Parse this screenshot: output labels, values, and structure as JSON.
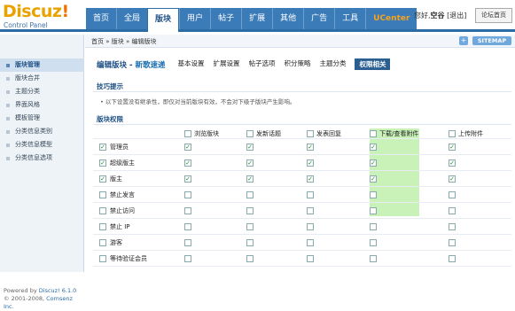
{
  "header": {
    "logo_word": "Discuz",
    "logo_bang": "!",
    "logo_sub": "Control Panel",
    "nav": [
      {
        "label": "首页",
        "active": false
      },
      {
        "label": "全局",
        "active": false
      },
      {
        "label": "版块",
        "active": true
      },
      {
        "label": "用户",
        "active": false
      },
      {
        "label": "帖子",
        "active": false
      },
      {
        "label": "扩展",
        "active": false
      },
      {
        "label": "其他",
        "active": false
      },
      {
        "label": "广告",
        "active": false
      },
      {
        "label": "工具",
        "active": false
      },
      {
        "label": "UCenter",
        "active": false
      }
    ],
    "greeting": "您好,",
    "username": "空谷",
    "logout": "[退出]",
    "home_button": "论坛首页"
  },
  "sidebar": {
    "items": [
      {
        "label": "版块管理",
        "active": true
      },
      {
        "label": "版块合并",
        "active": false
      },
      {
        "label": "主题分类",
        "active": false
      },
      {
        "label": "界面风格",
        "active": false
      },
      {
        "label": "模板管理",
        "active": false
      },
      {
        "label": "分类信息类别",
        "active": false
      },
      {
        "label": "分类信息模型",
        "active": false
      },
      {
        "label": "分类信息选项",
        "active": false
      }
    ],
    "footer_powered": "Powered by",
    "footer_product": "Discuz! 6.1.0",
    "footer_copy": "© 2001-2008,",
    "footer_company": "Comsenz Inc."
  },
  "main": {
    "breadcrumb": "首页 » 版块 » 编辑版块",
    "plus": "+",
    "sitemap": "SITEMAP",
    "title_prefix": "编辑版块 - ",
    "title_forum": "新歌速递",
    "subtabs": [
      {
        "label": "基本设置",
        "active": false
      },
      {
        "label": "扩展设置",
        "active": false
      },
      {
        "label": "帖子选项",
        "active": false
      },
      {
        "label": "积分策略",
        "active": false
      },
      {
        "label": "主题分类",
        "active": false
      },
      {
        "label": "权限相关",
        "active": true
      }
    ],
    "tips_title": "技巧提示",
    "tip_text": "• 以下设置没有继承性，即仅对当前版块有效，不会对下级子版块产生影响。",
    "perm_title": "版块权限",
    "columns": [
      "浏览版块",
      "发新话题",
      "发表回复",
      "下载/查看附件",
      "上传附件"
    ],
    "rows": [
      {
        "label": "管理员",
        "checked": true,
        "cells": [
          true,
          true,
          true,
          true,
          true
        ]
      },
      {
        "label": "超级版主",
        "checked": true,
        "cells": [
          true,
          true,
          true,
          true,
          true
        ]
      },
      {
        "label": "版主",
        "checked": true,
        "cells": [
          true,
          true,
          true,
          true,
          true
        ]
      },
      {
        "label": "禁止发言",
        "checked": false,
        "cells": [
          false,
          false,
          false,
          false,
          false
        ]
      },
      {
        "label": "禁止访问",
        "checked": false,
        "cells": [
          false,
          false,
          false,
          false,
          false
        ]
      },
      {
        "label": "禁止 IP",
        "checked": false,
        "cells": [
          false,
          false,
          false,
          false,
          false
        ]
      },
      {
        "label": "游客",
        "checked": false,
        "cells": [
          false,
          false,
          false,
          false,
          false
        ]
      },
      {
        "label": "等待验证会员",
        "checked": false,
        "cells": [
          false,
          false,
          false,
          false,
          false
        ]
      }
    ],
    "highlight_color": "#c8f2b8"
  }
}
